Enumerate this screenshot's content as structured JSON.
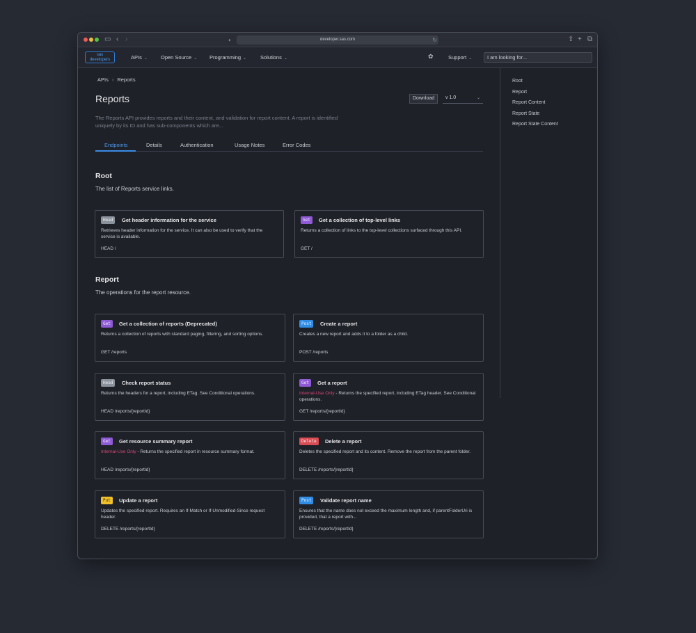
{
  "browser": {
    "url": "developer.sas.com"
  },
  "nav": {
    "logo_line1": "sas",
    "logo_line2": "developers",
    "items": [
      {
        "label": "APIs"
      },
      {
        "label": "Open Source"
      },
      {
        "label": "Programming"
      },
      {
        "label": "Solutions"
      }
    ],
    "support": "Support",
    "search_placeholder": "I am looking for..."
  },
  "breadcrumb": {
    "root": "APIs",
    "current": "Reports"
  },
  "page": {
    "title": "Reports",
    "download_label": "Download",
    "version": "v 1.0",
    "description": "The Reports API provides reports and their content, and validation for report content. A report is identified uniquely by its ID and has sub-components which are..."
  },
  "tabs": [
    "Endpoints",
    "Details",
    "Authentication",
    "Usage Notes",
    "Error Codes"
  ],
  "toc": [
    "Root",
    "Report",
    "Report Content",
    "Report State",
    "Report State Content"
  ],
  "sections": {
    "root": {
      "title": "Root",
      "desc": "The list of Reports service links."
    },
    "report": {
      "title": "Report",
      "desc": "The operations for the report resource."
    }
  },
  "cards": [
    {
      "method": "Head",
      "title": "Get header information for the service",
      "internal": "",
      "desc": "Retrieves header information for the service. It can also be used to verify that the service is available.",
      "path": "HEAD /"
    },
    {
      "method": "Get",
      "title": "Get a collection of top-level links",
      "internal": "",
      "desc": "Returns a collection of links to the top-level collections surfaced through this API.",
      "path": "GET /"
    },
    {
      "method": "Get",
      "title": "Get a collection of reports (Deprecated)",
      "internal": "",
      "desc": "Returns a collection of reports with standard paging, filtering, and sorting options.",
      "path": "GET /reports"
    },
    {
      "method": "Post",
      "title": "Create a report",
      "internal": "",
      "desc": "Creates a new report and adds it to a folder as a child.",
      "path": "POST /reports"
    },
    {
      "method": "Head",
      "title": "Check report status",
      "internal": "",
      "desc": "Returns the headers for a report, including ETag. See Conditional operations.",
      "path": "HEAD /reports/{reportId}"
    },
    {
      "method": "Get",
      "title": "Get a report",
      "internal": "Internal-Use Only",
      "desc": " - Returns the specified report, including ETag header. See Conditional operations.",
      "path": "GET /reports/{reportId}"
    },
    {
      "method": "Get",
      "title": "Get resource summary report",
      "internal": "Internal-Use Only",
      "desc": " - Returns the specified report in resource summary format.",
      "path": "HEAD /reports/{reportId}"
    },
    {
      "method": "Delete",
      "title": "Delete a report",
      "internal": "",
      "desc": "Deletes the specified report and its content. Remove the report from the parent folder.",
      "path": "DELETE /reports/{reportId}"
    },
    {
      "method": "Put",
      "title": "Update a report",
      "internal": "",
      "desc": "Updates the specified report. Requires an If-Match or If-Unmodified-Since request header.",
      "path": "DELETE /reports/{reportId}"
    },
    {
      "method": "Post",
      "title": "Validate report name",
      "internal": "",
      "desc": "Ensures that the name does not exceed the maximum length and, if parentFolderUri is provided, that a report with...",
      "path": "DELETE /reports/{reportId}"
    }
  ],
  "colors": {
    "accent": "#3a8ce6",
    "get": "#8f5ad6",
    "head": "#8c929c",
    "post": "#2f8de6",
    "delete": "#d94c54",
    "put": "#f0c12c",
    "internal": "#d2477a"
  }
}
